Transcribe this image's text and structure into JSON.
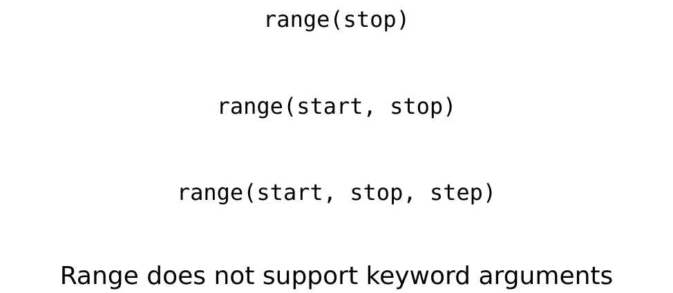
{
  "signatures": [
    "range(stop)",
    "range(start, stop)",
    "range(start, stop, step)"
  ],
  "note": "Range does not support keyword arguments"
}
